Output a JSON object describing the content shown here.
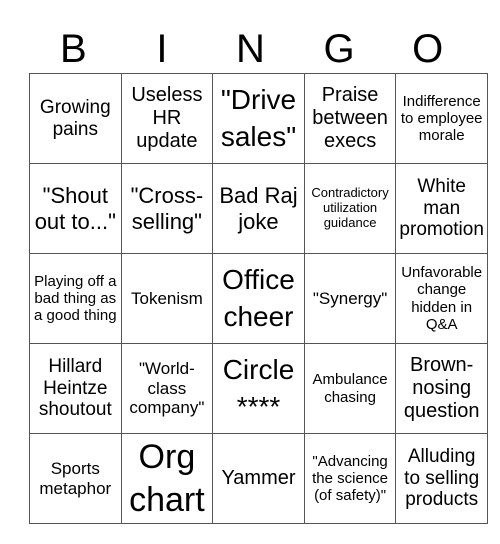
{
  "title_letters": [
    "B",
    "I",
    "N",
    "G",
    "O"
  ],
  "rows": [
    [
      "Growing pains",
      "Useless HR update",
      "\"Drive sales\"",
      "Praise between execs",
      "Indifference to employee morale"
    ],
    [
      "\"Shout out to...\"",
      "\"Cross-selling\"",
      "Bad Raj joke",
      "Contradictory utilization guidance",
      "White man promotion"
    ],
    [
      "Playing off a bad thing as a good thing",
      "Tokenism",
      "Office cheer",
      "\"Synergy\"",
      "Unfavorable change hidden in Q&A"
    ],
    [
      "Hillard Heintze shoutout",
      "\"World-class company\"",
      "Circle ****",
      "Ambulance chasing",
      "Brown-nosing question"
    ],
    [
      "Sports metaphor",
      "Org chart",
      "Yammer",
      "\"Advancing the science (of safety)\"",
      "Alluding to selling products"
    ]
  ]
}
